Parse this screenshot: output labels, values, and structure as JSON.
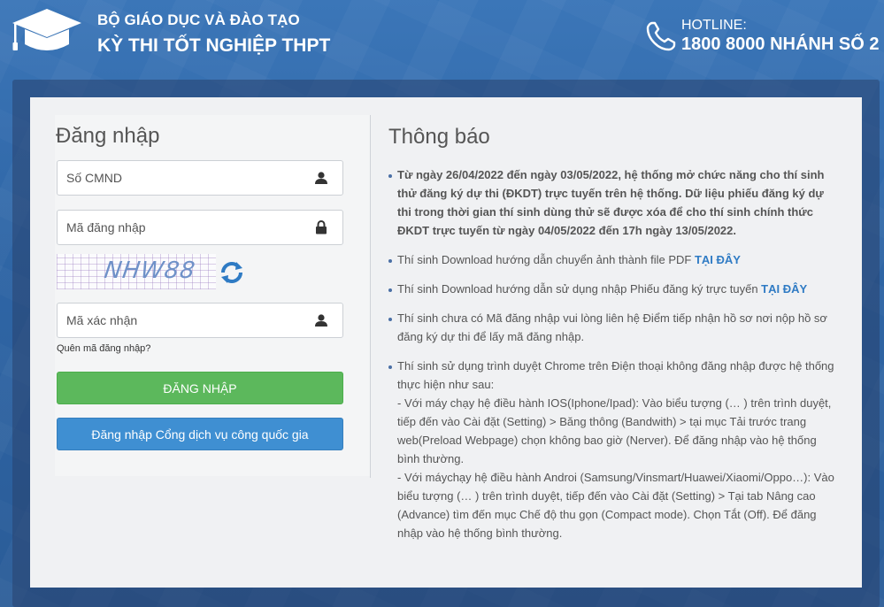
{
  "header": {
    "org_name": "BỘ GIÁO DỤC VÀ ĐÀO TẠO",
    "exam_name": "KỲ THI TỐT NGHIỆP THPT",
    "hotline_label": "HOTLINE:",
    "hotline_number": "1800 8000 NHÁNH SỐ 2",
    "logo_icon": "graduation-cap-icon",
    "phone_icon": "phone-icon"
  },
  "login": {
    "title": "Đăng nhập",
    "cmnd_placeholder": "Số CMND",
    "code_placeholder": "Mã đăng nhập",
    "captcha_text": "NHW88",
    "captcha_placeholder": "Mã xác nhận",
    "forgot_label": "Quên mã đăng nhập?",
    "submit_label": "ĐĂNG NHẬP",
    "national_portal_label": "Đăng nhập Cổng dịch vụ công quốc gia"
  },
  "notice": {
    "title": "Thông báo",
    "items": [
      {
        "text": "Từ ngày 26/04/2022 đến ngày 03/05/2022, hệ thống mở chức năng cho thí sinh thử đăng ký dự thi (ĐKDT) trực tuyến trên hệ thống. Dữ liệu phiếu đăng ký dự thi trong thời gian thí sinh dùng thử sẽ được xóa để cho thí sinh chính thức ĐKDT trực tuyến từ ngày 04/05/2022 đến 17h ngày 13/05/2022."
      },
      {
        "text": "Thí sinh Download hướng dẫn chuyển ảnh thành file PDF ",
        "link": "TẠI ĐÂY"
      },
      {
        "text": "Thí sinh Download hướng dẫn sử dụng nhập Phiếu đăng ký trực tuyến ",
        "link": "TẠI ĐÂY"
      },
      {
        "text": "Thí sinh chưa có Mã đăng nhập vui lòng liên hệ Điểm tiếp nhận hồ sơ nơi nộp hồ sơ đăng ký dự thi để lấy mã đăng nhập."
      },
      {
        "text": "Thí sinh sử dụng trình duyệt Chrome trên Điện thoại không đăng nhập được hệ thống thực hiện như sau:",
        "sub1": " - Với máy chạy hệ điều hành IOS(Iphone/Ipad): Vào biểu tượng (… ) trên trình duyệt, tiếp đến vào Cài đặt (Setting) > Băng thông (Bandwith) > tại mục Tải trước trang web(Preload Webpage) chọn không bao giờ (Nerver). Để đăng nhập vào hệ thống bình thường.",
        "sub2": " - Với máychạy hệ điều hành Androi (Samsung/Vinsmart/Huawei/Xiaomi/Oppo…): Vào biểu tượng (… ) trên trình duyệt, tiếp đến vào Cài đặt (Setting) > Tại tab Nâng cao (Advance) tìm đến mục Chế độ thu gọn (Compact mode). Chọn Tắt (Off). Để đăng nhập vào hệ thống bình thường."
      }
    ]
  },
  "colors": {
    "background": "#3b76b8",
    "submit_button": "#5cb85c",
    "portal_button": "#3f8fd2",
    "link": "#2f7bc4"
  }
}
